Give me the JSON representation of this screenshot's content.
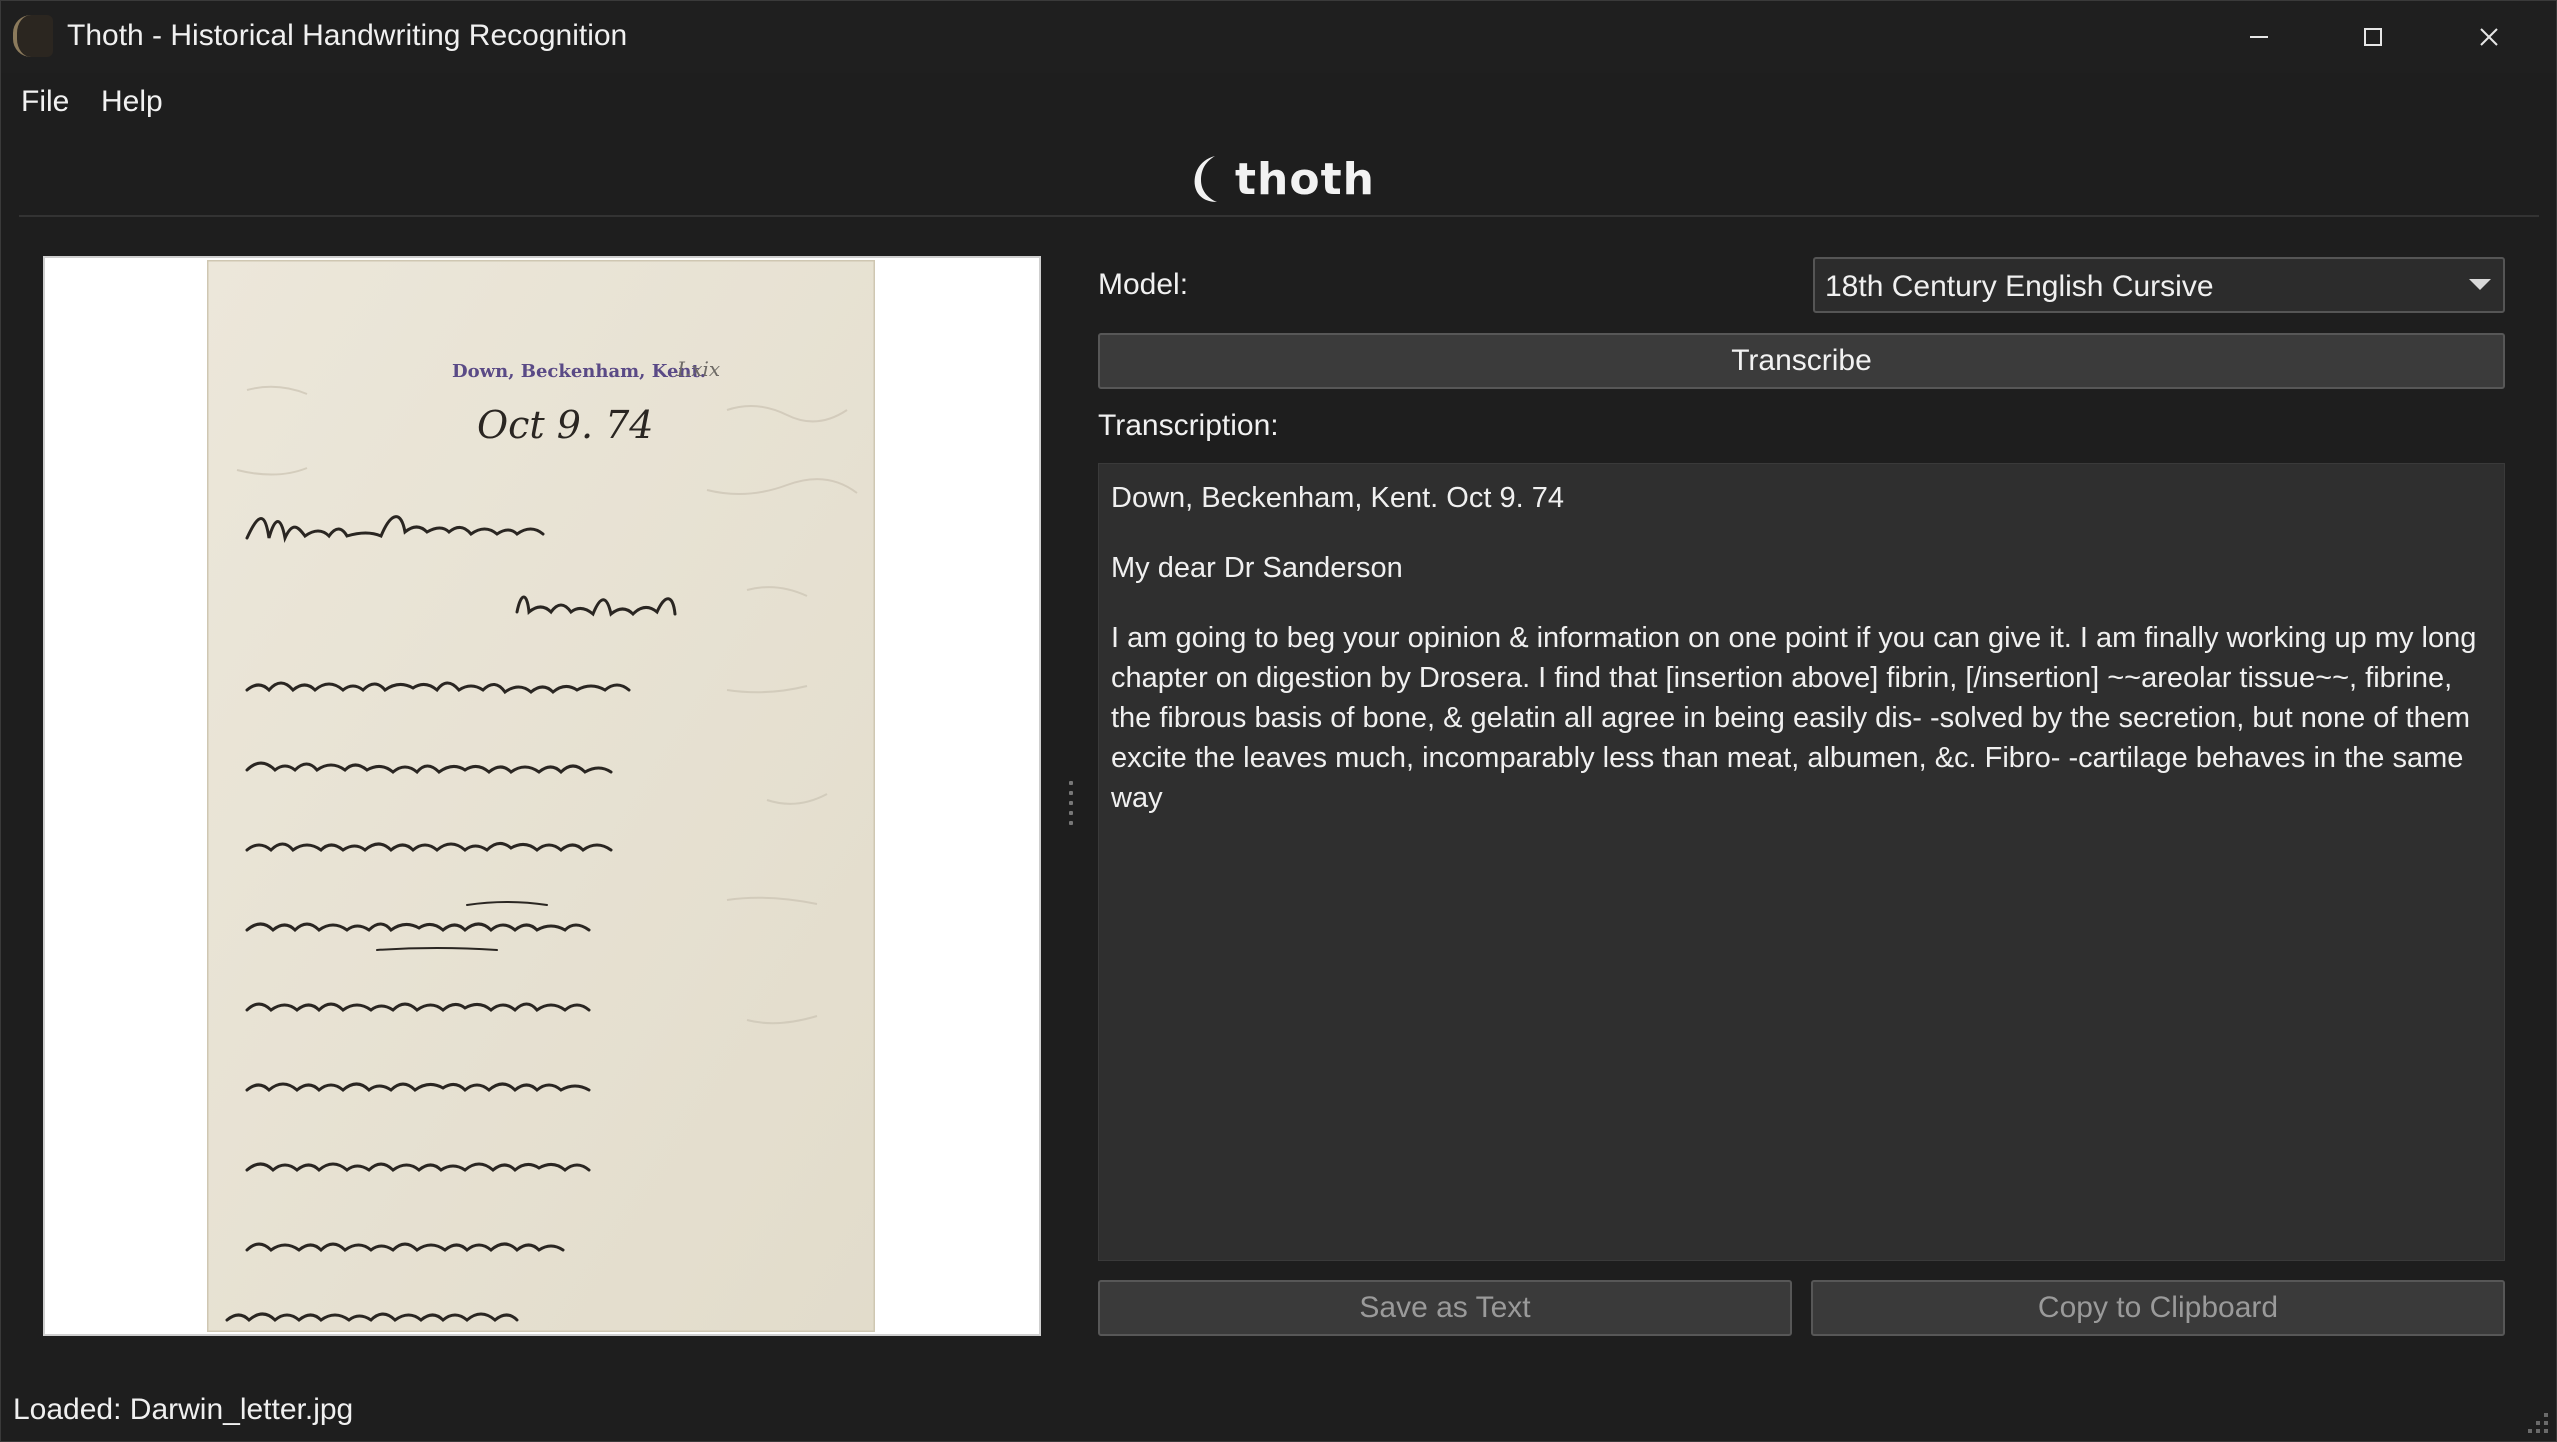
{
  "window": {
    "title": "Thoth - Historical Handwriting Recognition",
    "app_icon_text": "thoth"
  },
  "menu": {
    "file": "File",
    "help": "Help"
  },
  "header": {
    "logo_text": "thoth"
  },
  "image_pane": {
    "letterhead": "Down, Beckenham, Kent.",
    "letter_date": "Oct 9. 74",
    "folio_mark": "I.xix"
  },
  "controls": {
    "model_label": "Model:",
    "model_selected": "18th Century English Cursive",
    "transcribe_button": "Transcribe",
    "transcription_label": "Transcription:",
    "save_button": "Save as Text",
    "copy_button": "Copy to Clipboard"
  },
  "transcription": {
    "paragraphs": [
      "Down, Beckenham, Kent. Oct 9. 74",
      "My dear Dr Sanderson",
      "I am going to beg your opinion & information on one point if you can give it. I am finally working up my long chapter on digestion by Drosera. I find that [insertion above] fibrin, [/insertion] ~~areolar tissue~~, fibrine, the fibrous basis of bone, & gelatin all agree in being easily dis- -solved by the secretion, but none of them excite the leaves much, incomparably less than meat, albumen, &c. Fibro- -cartilage behaves in the same way"
    ]
  },
  "status": {
    "text": "Loaded: Darwin_letter.jpg"
  },
  "colors": {
    "background": "#1e1e1e",
    "panel": "#2f2f2f",
    "button": "#3b3b3b",
    "text": "#f0f0f0",
    "disabled_text": "#9a9a9a",
    "paper": "#e9e4d6",
    "ink": "#2a2622"
  }
}
